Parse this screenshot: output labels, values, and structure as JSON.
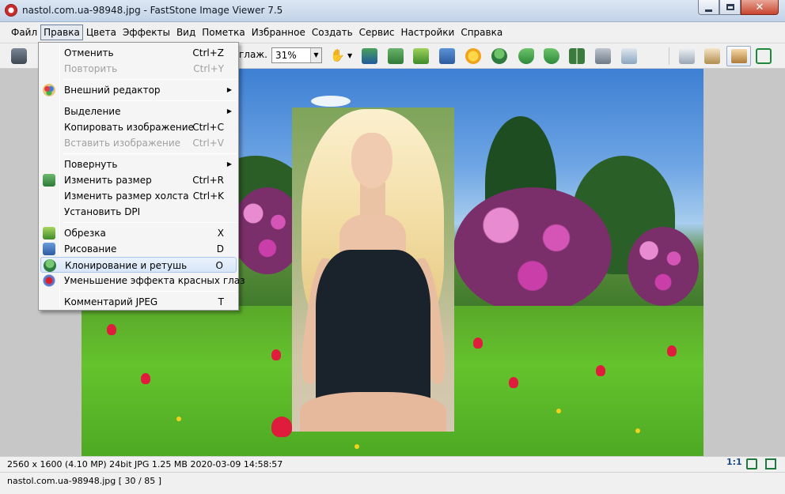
{
  "window": {
    "title": "nastol.com.ua-98948.jpg  -  FastStone Image Viewer 7.5"
  },
  "menubar": {
    "items": [
      {
        "label": "Файл"
      },
      {
        "label": "Правка",
        "active": true
      },
      {
        "label": "Цвета"
      },
      {
        "label": "Эффекты"
      },
      {
        "label": "Вид"
      },
      {
        "label": "Пометка"
      },
      {
        "label": "Избранное"
      },
      {
        "label": "Создать"
      },
      {
        "label": "Сервис"
      },
      {
        "label": "Настройки"
      },
      {
        "label": "Справка"
      }
    ]
  },
  "toolbar": {
    "smooth_label": "глаж.",
    "zoom_value": "31%",
    "zoom_arrow": "▼",
    "hand_glyph": "✋",
    "hand_caret": "▼"
  },
  "edit_menu": {
    "items": [
      {
        "label": "Отменить",
        "shortcut": "Ctrl+Z"
      },
      {
        "label": "Повторить",
        "shortcut": "Ctrl+Y",
        "disabled": true
      },
      {
        "label": "Внешний редактор",
        "submenu": true,
        "icon": "palette-icon"
      },
      {
        "label": "Выделение",
        "submenu": true
      },
      {
        "label": "Копировать изображение",
        "shortcut": "Ctrl+C"
      },
      {
        "label": "Вставить изображение",
        "shortcut": "Ctrl+V",
        "disabled": true
      },
      {
        "label": "Повернуть",
        "submenu": true
      },
      {
        "label": "Изменить размер",
        "shortcut": "Ctrl+R",
        "icon": "resize-icon"
      },
      {
        "label": "Изменить размер холста",
        "shortcut": "Ctrl+K"
      },
      {
        "label": "Установить DPI"
      },
      {
        "label": "Обрезка",
        "shortcut": "X",
        "icon": "crop-icon"
      },
      {
        "label": "Рисование",
        "shortcut": "D",
        "icon": "draw-icon"
      },
      {
        "label": "Клонирование и ретушь",
        "shortcut": "O",
        "icon": "clone-icon",
        "highlighted": true
      },
      {
        "label": "Уменьшение эффекта красных глаз",
        "icon": "red-eye-icon"
      },
      {
        "label": "Комментарий JPEG",
        "shortcut": "T"
      }
    ],
    "submenu_arrow": "▶"
  },
  "status": {
    "info": "2560 x 1600 (4.10 MP)  24bit  JPG   1.25 MB   2020-03-09 14:58:57",
    "ratio": "1:1",
    "file": "nastol.com.ua-98948.jpg [ 30 / 85 ]"
  },
  "colors": {
    "accent": "#1a4a8a",
    "highlight": "#d7e6f8",
    "close_button": "#c7452f"
  }
}
